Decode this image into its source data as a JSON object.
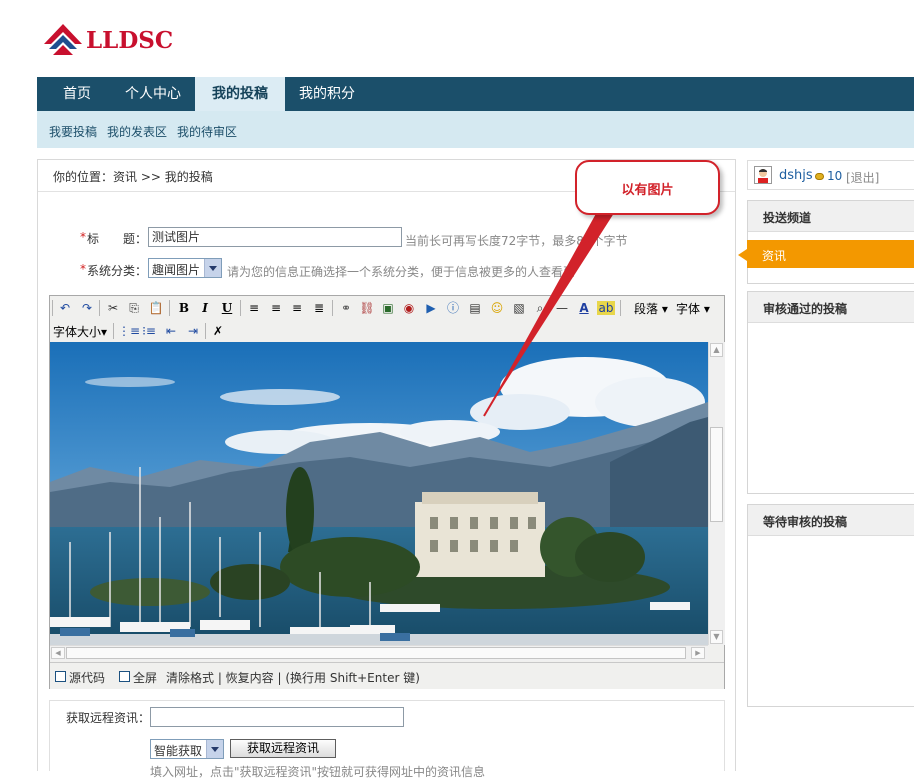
{
  "logo": {
    "text": "LLDSC"
  },
  "nav": {
    "items": [
      {
        "label": "首页"
      },
      {
        "label": "个人中心"
      },
      {
        "label": "我的投稿"
      },
      {
        "label": "我的积分"
      }
    ],
    "sub": [
      {
        "label": "我要投稿"
      },
      {
        "label": "我的发表区"
      },
      {
        "label": "我的待审区"
      }
    ]
  },
  "breadcrumb": {
    "text": "你的位置：资讯  >> 我的投稿"
  },
  "form": {
    "title_req": "*",
    "title_label": "标　　题：",
    "title_value": "测试图片",
    "title_hint": "当前长可再写长度72字节，最多80个字节",
    "category_req": "*",
    "category_label": "系统分类：",
    "category_value": "趣闻图片",
    "category_hint": "请为您的信息正确选择一个系统分类，便于信息被更多的人查看到"
  },
  "toolbar": {
    "paragraph": "段落",
    "font": "字体",
    "font_size": "字体大小"
  },
  "editor_footer": {
    "source": "源代码",
    "fullscreen": "全屏",
    "rest": "清除格式 | 恢复内容 | (换行用 Shift+Enter 键)"
  },
  "remote": {
    "label": "获取远程资讯：",
    "mode_value": "智能获取",
    "button": "获取远程资讯",
    "hint": "填入网址，点击\"获取远程资讯\"按钮就可获得网址中的资讯信息"
  },
  "user": {
    "name": "dshjs",
    "points": "10",
    "logout": "[退出]"
  },
  "side": {
    "channel_title": "投送频道",
    "channel_item": "资讯",
    "approved_title": "审核通过的投稿",
    "pending_title": "等待审核的投稿"
  },
  "annotation": {
    "text": "以有图片"
  },
  "colors": {
    "nav_bg": "#1b4f6a",
    "subnav_bg": "#d5e9f1",
    "accent_orange": "#f39800",
    "callout_red": "#d2222a"
  }
}
